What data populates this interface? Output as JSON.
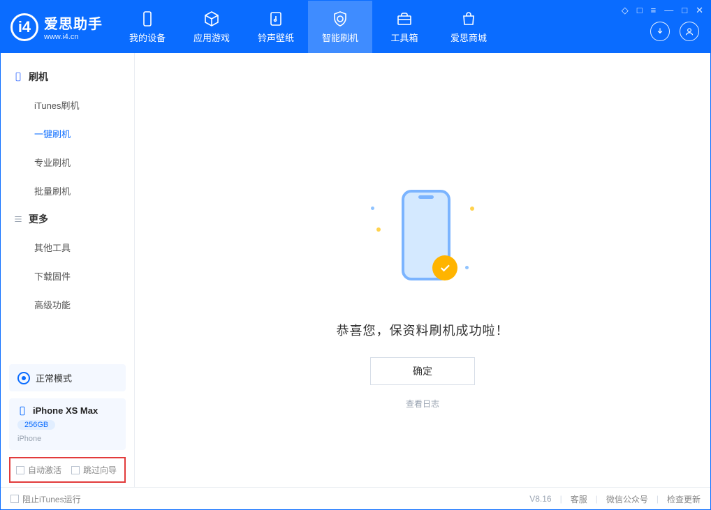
{
  "app": {
    "name_zh": "爱思助手",
    "name_en": "www.i4.cn"
  },
  "tabs": [
    {
      "id": "device",
      "label": "我的设备"
    },
    {
      "id": "apps",
      "label": "应用游戏"
    },
    {
      "id": "ring",
      "label": "铃声壁纸"
    },
    {
      "id": "flash",
      "label": "智能刷机"
    },
    {
      "id": "toolbox",
      "label": "工具箱"
    },
    {
      "id": "store",
      "label": "爱思商城"
    }
  ],
  "active_tab": "flash",
  "window_controls": {
    "pin": "◇",
    "feedback": "□",
    "menu": "≡",
    "min": "—",
    "max": "□",
    "close": "✕"
  },
  "sidebar": {
    "group1_title": "刷机",
    "group1_items": [
      "iTunes刷机",
      "一键刷机",
      "专业刷机",
      "批量刷机"
    ],
    "group1_active_index": 1,
    "group2_title": "更多",
    "group2_items": [
      "其他工具",
      "下载固件",
      "高级功能"
    ],
    "mode_label": "正常模式",
    "device": {
      "name": "iPhone XS Max",
      "capacity": "256GB",
      "type": "iPhone"
    },
    "options": {
      "auto_activate": "自动激活",
      "skip_guide": "跳过向导"
    }
  },
  "main": {
    "success_msg": "恭喜您，保资料刷机成功啦！",
    "ok_button": "确定",
    "view_log": "查看日志"
  },
  "footer": {
    "block_itunes": "阻止iTunes运行",
    "version": "V8.16",
    "links": [
      "客服",
      "微信公众号",
      "检查更新"
    ]
  }
}
